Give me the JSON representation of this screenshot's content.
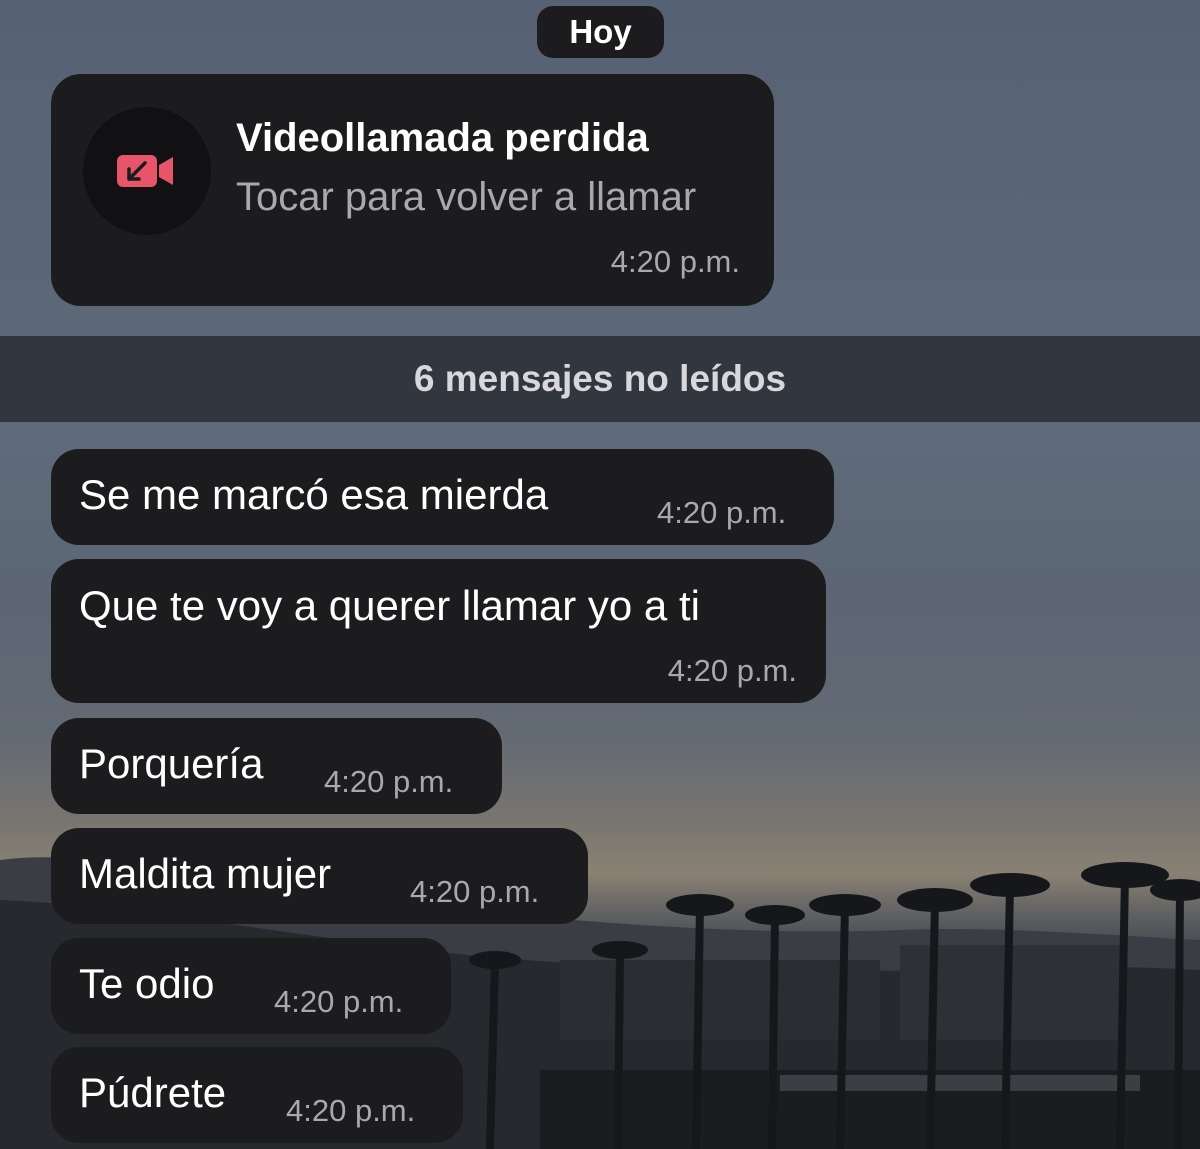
{
  "date_separator": "Hoy",
  "missed_call": {
    "icon": "missed-video-call-icon",
    "title": "Videollamada perdida",
    "subtitle": "Tocar para volver a llamar",
    "time": "4:20 p.m."
  },
  "unread_banner": "6 mensajes no leídos",
  "messages": [
    {
      "text": "Se me marcó esa mierda",
      "time": "4:20 p.m."
    },
    {
      "text": "Que te voy a querer llamar yo a ti",
      "time": "4:20 p.m."
    },
    {
      "text": "Porquería",
      "time": "4:20 p.m."
    },
    {
      "text": "Maldita mujer",
      "time": "4:20 p.m."
    },
    {
      "text": "Te odio",
      "time": "4:20 p.m."
    },
    {
      "text": "Púdrete",
      "time": "4:20 p.m."
    }
  ],
  "colors": {
    "bubble": "#1c1c1e",
    "missed_call_accent": "#e8546a",
    "timestamp": "#a8a8ad"
  }
}
